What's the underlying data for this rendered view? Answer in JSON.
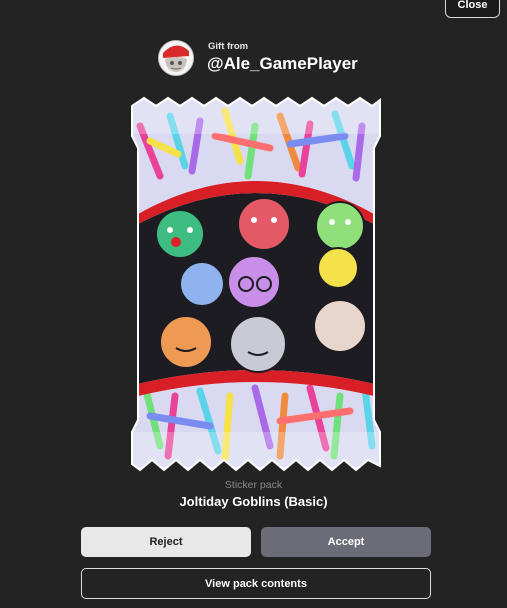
{
  "header": {
    "close_label": "Close"
  },
  "gift": {
    "from_label": "Gift from",
    "sender_username": "@Ale_GamePlayer"
  },
  "pack": {
    "type_label": "Sticker pack",
    "name": "Joltiday Goblins (Basic)"
  },
  "actions": {
    "reject_label": "Reject",
    "accept_label": "Accept",
    "view_contents_label": "View pack contents"
  },
  "colors": {
    "background": "#232323",
    "accept_button": "#6c6c78",
    "reject_button": "#e8e8e8",
    "pack_band_red": "#d81f26"
  }
}
